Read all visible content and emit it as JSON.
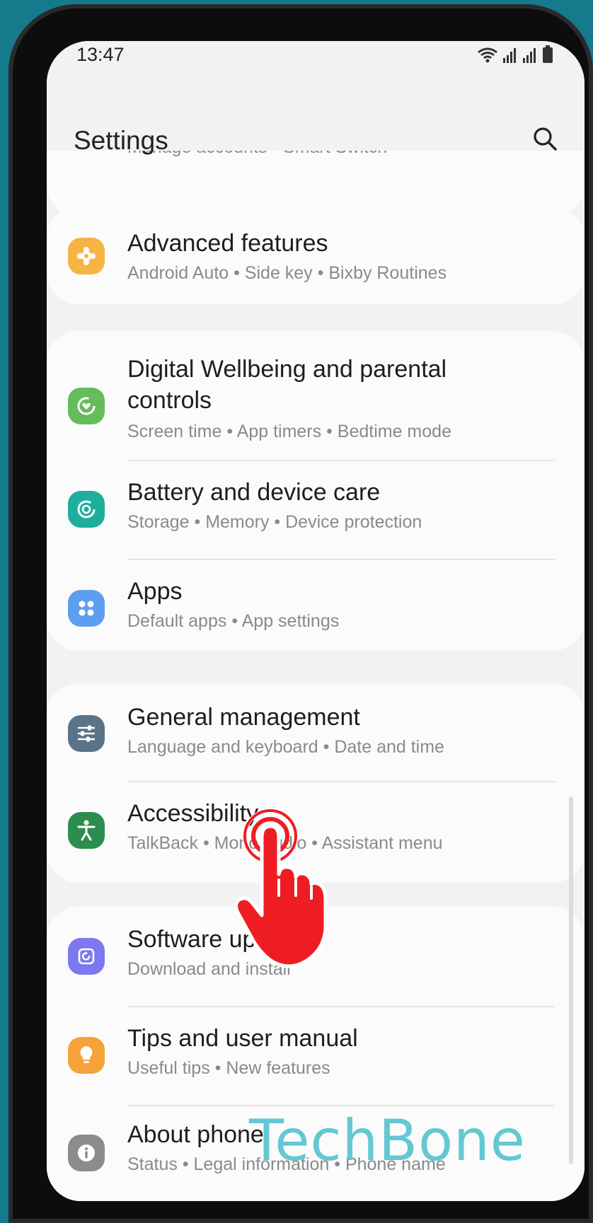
{
  "status_bar": {
    "time": "13:47"
  },
  "header": {
    "title": "Settings"
  },
  "partial_item": {
    "subtitle": "Manage accounts  •  Smart Switch"
  },
  "items": [
    {
      "title": "Advanced features",
      "subtitle": "Android Auto  •  Side key  •  Bixby Routines",
      "icon": "puzzle-gear-icon",
      "color": "#f6b444"
    },
    {
      "title": "Digital Wellbeing and parental",
      "title2": "controls",
      "subtitle": "Screen time  •  App timers  •  Bedtime mode",
      "icon": "wellbeing-heart-icon",
      "color": "#66bb5a"
    },
    {
      "title": "Battery and device care",
      "subtitle": "Storage  •  Memory  •  Device protection",
      "icon": "device-care-icon",
      "color": "#1fae9c"
    },
    {
      "title": "Apps",
      "subtitle": "Default apps  •  App settings",
      "icon": "apps-grid-icon",
      "color": "#5e9ef0"
    },
    {
      "title": "General management",
      "subtitle": "Language and keyboard  •  Date and time",
      "icon": "sliders-icon",
      "color": "#5a7388"
    },
    {
      "title": "Accessibility",
      "subtitle": "TalkBack  •  Mono audio  •  Assistant menu",
      "icon": "accessibility-person-icon",
      "color": "#2c8e4e"
    },
    {
      "title": "Software update",
      "subtitle": "Download and install",
      "icon": "software-update-icon",
      "color": "#7c78ee"
    },
    {
      "title": "Tips and user manual",
      "subtitle": "Useful tips  •  New features",
      "icon": "lightbulb-icon",
      "color": "#f6a23a"
    },
    {
      "title": "About phone",
      "subtitle": "Status  •  Legal information  •  Phone name",
      "icon": "info-icon",
      "color": "#8c8c8c"
    }
  ],
  "watermark": "TechBone"
}
